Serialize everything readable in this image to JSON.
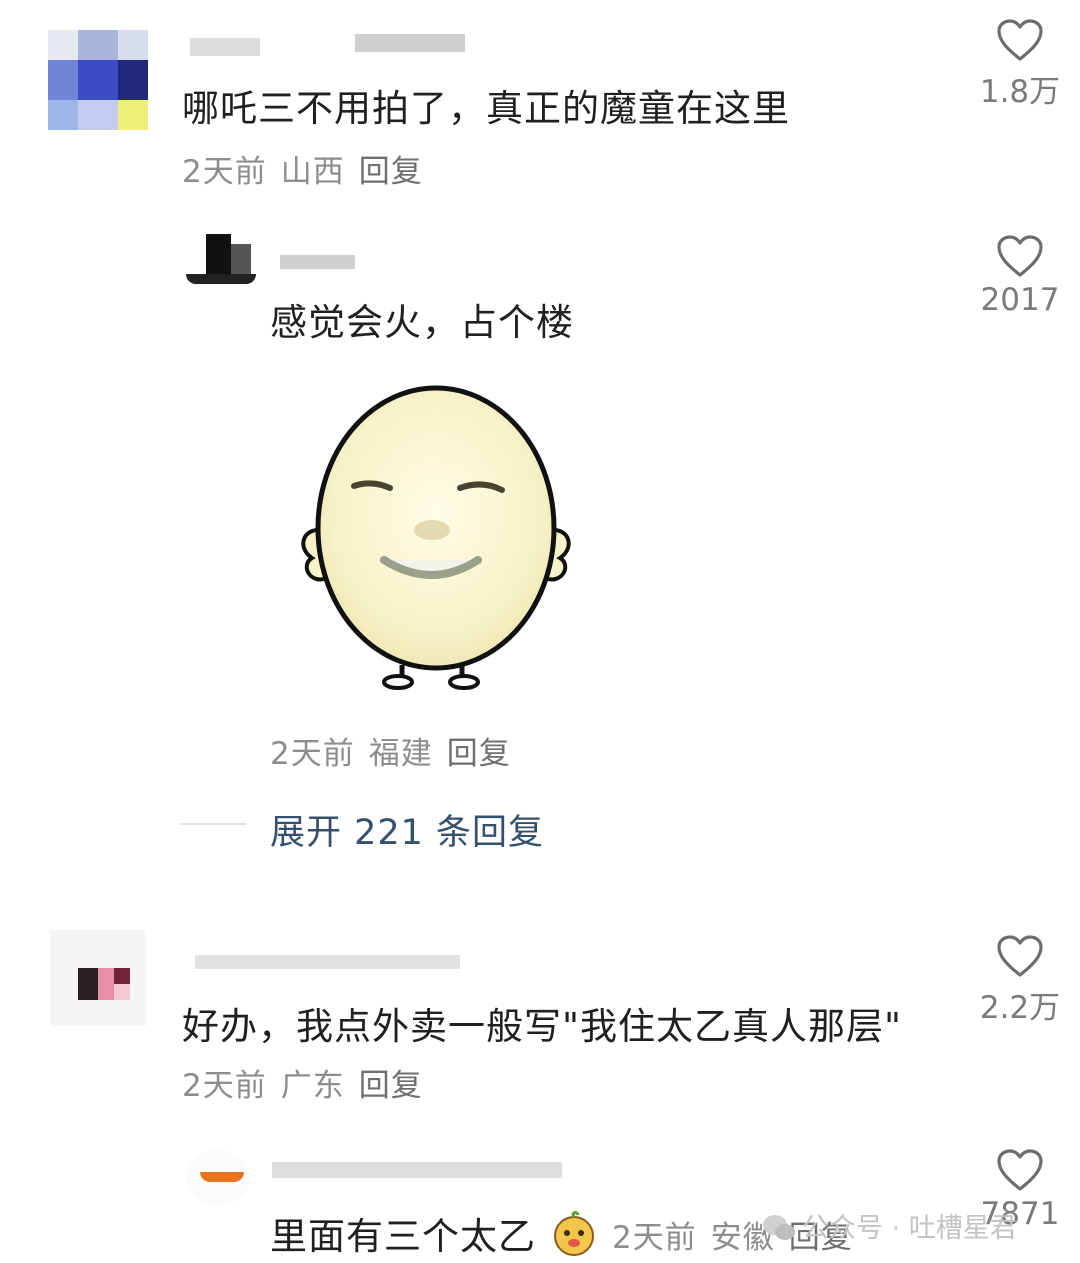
{
  "comments": [
    {
      "text": "哪吒三不用拍了，真正的魔童在这里",
      "time": "2天前",
      "location": "山西",
      "reply_label": "回复",
      "likes": "1.8万",
      "replies": [
        {
          "text": "感觉会火，占个楼",
          "time": "2天前",
          "location": "福建",
          "reply_label": "回复",
          "likes": "2017"
        }
      ],
      "expand_label": "展开 221 条回复"
    },
    {
      "text": "好办，我点外卖一般写\"我住太乙真人那层\"",
      "time": "2天前",
      "location": "广东",
      "reply_label": "回复",
      "likes": "2.2万",
      "replies": [
        {
          "text": "里面有三个太乙",
          "time": "2天前",
          "location": "安徽",
          "reply_label": "回复",
          "likes": "7871"
        }
      ]
    }
  ],
  "watermark": "公众号 · 吐槽星君",
  "icons": {
    "like": "heart-outline-icon",
    "emoji": "cartoon-face-emoji-icon",
    "watermark": "wechat-icon"
  }
}
